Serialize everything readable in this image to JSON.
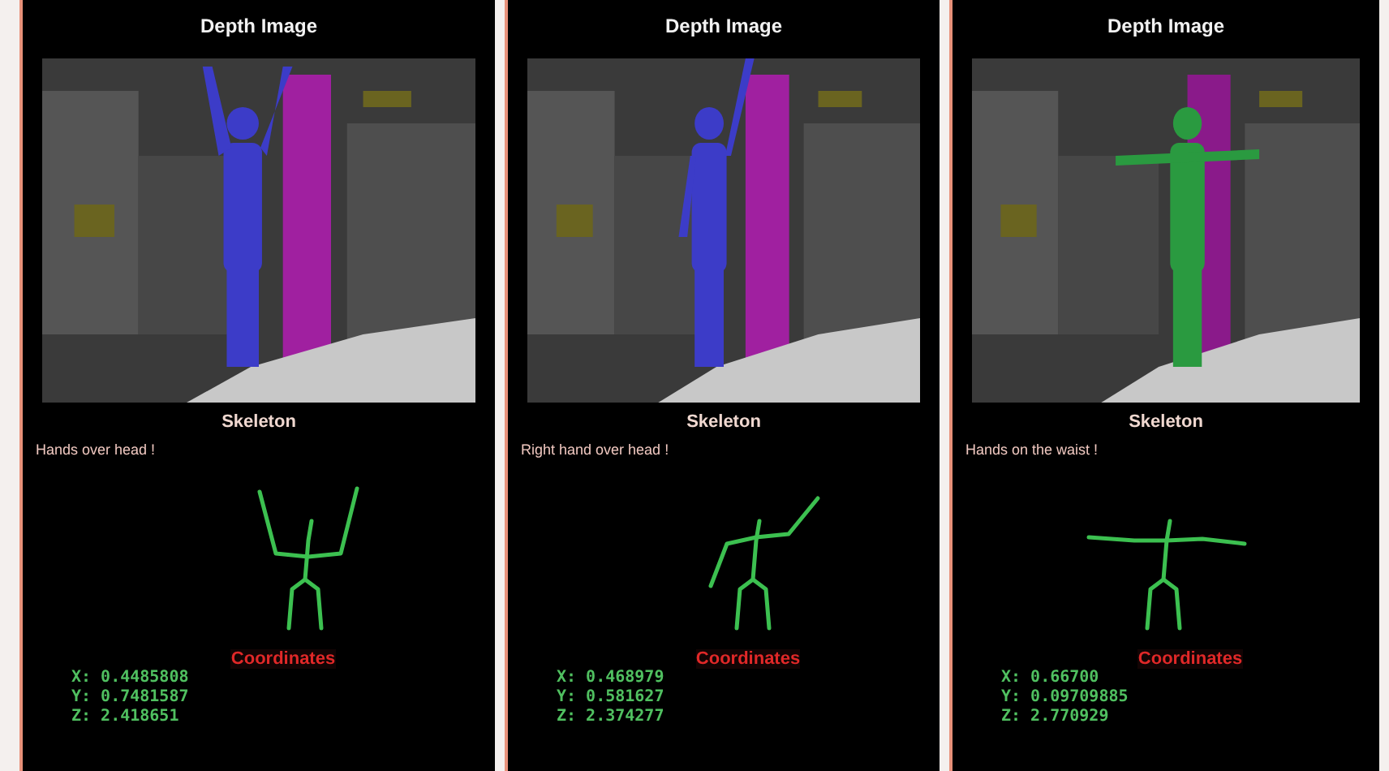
{
  "panels": [
    {
      "title": "Depth Image",
      "section": "Skeleton",
      "gesture": "Hands over head !",
      "kind": "hands",
      "coordinates_title": "Coordinates",
      "coordinates": [
        "X: 0.4485808",
        "Y: 0.7481587",
        "Z: 2.418651"
      ]
    },
    {
      "title": "Depth Image",
      "section": "Skeleton",
      "gesture": "Right hand over head !",
      "kind": "right",
      "coordinates_title": "Coordinates",
      "coordinates": [
        "X: 0.468979",
        "Y: 0.581627",
        "Z: 2.374277"
      ]
    },
    {
      "title": "Depth Image",
      "section": "Skeleton",
      "gesture": "Hands on the waist !",
      "kind": "out",
      "coordinates_title": "Coordinates",
      "coordinates": [
        "X: 0.66700",
        "Y: 0.09709885",
        "Z: 2.770929"
      ]
    }
  ]
}
